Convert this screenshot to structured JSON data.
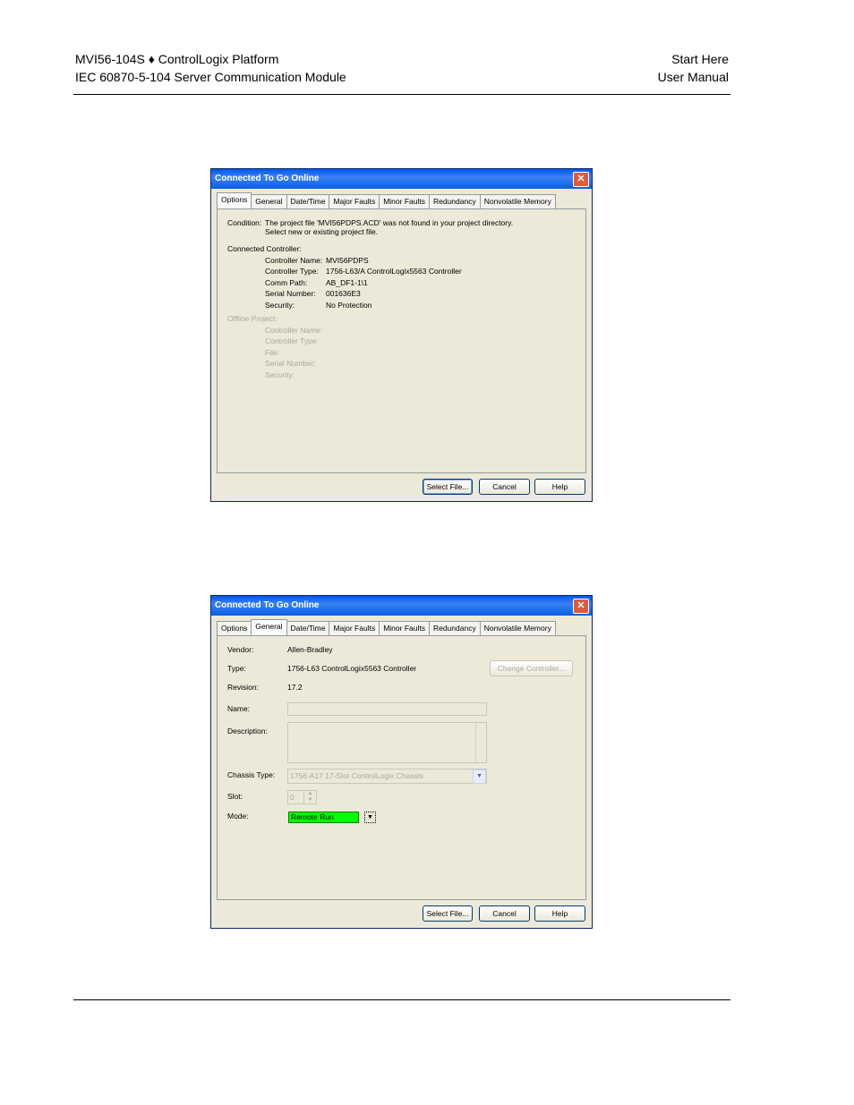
{
  "header": {
    "left_line1": "MVI56-104S ♦ ControlLogix Platform",
    "left_line2": "IEC 60870-5-104 Server Communication Module",
    "right_line1": "Start Here",
    "right_line2": "User Manual"
  },
  "dialog1": {
    "title": "Connected To Go Online",
    "close": "✕",
    "tabs": [
      "Options",
      "General",
      "Date/Time",
      "Major Faults",
      "Minor Faults",
      "Redundancy",
      "Nonvolatile Memory"
    ],
    "condition_label": "Condition:",
    "condition_line1": "The project file 'MVI56PDPS.ACD' was not found in your project directory.",
    "condition_line2": "Select new or existing project file.",
    "connected_label": "Connected Controller:",
    "connected": [
      {
        "label": "Controller Name:",
        "value": "MVI56PDPS"
      },
      {
        "label": "Controller Type:",
        "value": "1756-L63/A ControlLogix5563 Controller"
      },
      {
        "label": "Comm Path:",
        "value": "AB_DF1-1\\1"
      },
      {
        "label": "Serial Number:",
        "value": "001636E3"
      },
      {
        "label": "Security:",
        "value": "No Protection"
      }
    ],
    "offline_label": "Offline Project:",
    "offline": [
      "Controller Name:",
      "Controller Type:",
      "File:",
      "Serial Number:",
      "Security:"
    ],
    "buttons": {
      "select": "Select File...",
      "cancel": "Cancel",
      "help": "Help"
    }
  },
  "dialog2": {
    "title": "Connected To Go Online",
    "close": "✕",
    "tabs": [
      "Options",
      "General",
      "Date/Time",
      "Major Faults",
      "Minor Faults",
      "Redundancy",
      "Nonvolatile Memory"
    ],
    "vendor_label": "Vendor:",
    "vendor": "Allen-Bradley",
    "type_label": "Type:",
    "type": "1756-L63 ControlLogix5563 Controller",
    "change_controller": "Change Controller...",
    "revision_label": "Revision:",
    "revision": "17.2",
    "name_label": "Name:",
    "name_value": "",
    "description_label": "Description:",
    "chassis_label": "Chassis Type:",
    "chassis_value": "1756-A17   17-Slot ControlLogix Chassis",
    "slot_label": "Slot:",
    "slot_value": "0",
    "mode_label": "Mode:",
    "mode_value": "Remote Run",
    "buttons": {
      "select": "Select File...",
      "cancel": "Cancel",
      "help": "Help"
    }
  }
}
